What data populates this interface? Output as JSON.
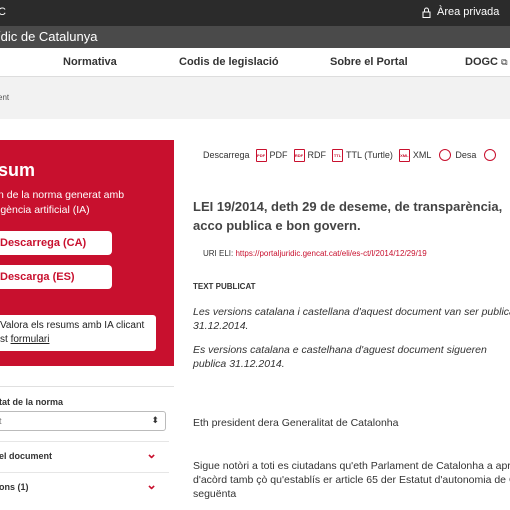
{
  "topbar": {
    "left_text": "C",
    "area_label": "Àrea privada"
  },
  "title": "ídic de Catalunya",
  "nav": {
    "items": [
      "Normativa",
      "Codis de legislació",
      "Sobre el Portal",
      "DOGC"
    ]
  },
  "breadcrumb": "ent",
  "summary": {
    "heading": "sum",
    "sub": "n de la norma generat amb\nigència artificial (IA)",
    "download_ca": "Descarrega (CA)",
    "download_es": "Descarga (ES)",
    "note_line1": "Valora els resums amb IA clicant",
    "note_line2_prefix": "st ",
    "note_link": "formulari"
  },
  "sidebar": {
    "filter_label": "tat de la norma",
    "filter_value": "t",
    "rows": [
      "el document",
      "ons (1)"
    ]
  },
  "tools": {
    "label": "Descarrega",
    "pdf": "PDF",
    "rdf": "RDF",
    "ttl": "TTL (Turtle)",
    "xml": "XML",
    "save": "Desa"
  },
  "law_title": "LEI 19/2014, deth 29 de deseme, de transparència, acco publica e bon govern.",
  "eli": {
    "label": "URI ELI:",
    "url": "https://portaljuridic.gencat.cat/eli/es-ct/l/2014/12/29/19"
  },
  "text_label": "TEXT PUBLICAT",
  "italic1": "Les versions catalana i castellana d'aquest document van ser publicad 31.12.2014.",
  "italic2": "Es versions catalana e castelhana d'aguest document sigueren publica 31.12.2014.",
  "para1": "Eth president dera Generalitat de Catalonha",
  "para2": "Sigue notòri a toti es ciutadans qu'eth Parlament de Catalonha a aprov d'acòrd tamb çò qu'establís er article 65 der Estatut d'autonomia de Ca seguënta",
  "colors": {
    "brand_red": "#c8102e",
    "topbar": "#2b2b2b",
    "titlebar": "#4a4a4a"
  }
}
